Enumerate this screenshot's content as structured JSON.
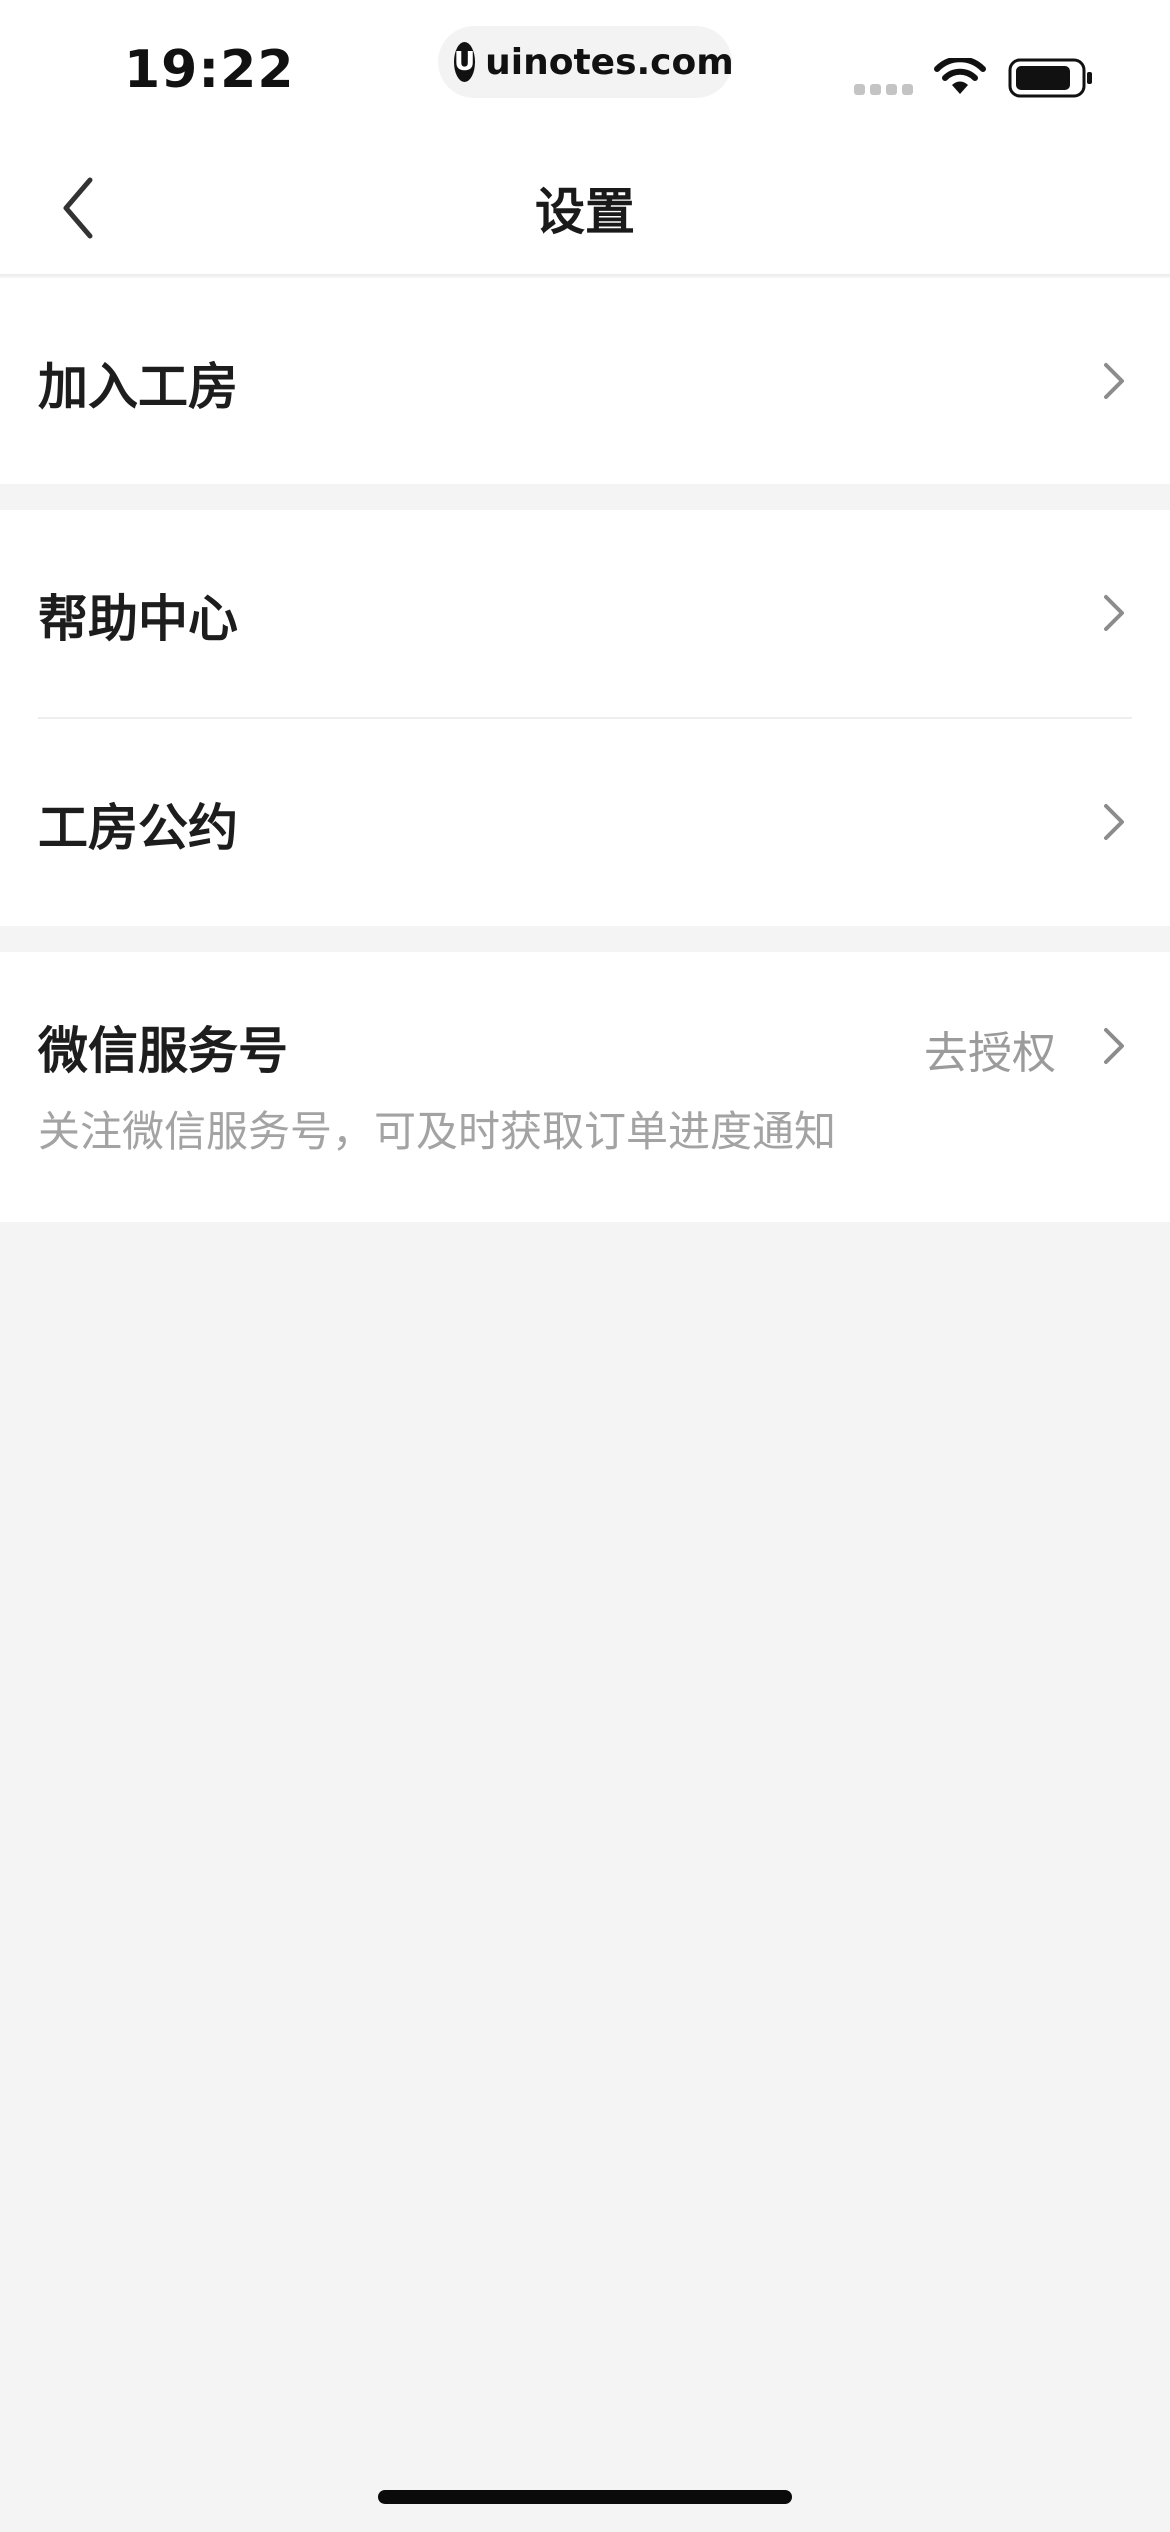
{
  "status_bar": {
    "time": "19:22",
    "url_logo": "U",
    "url": "uinotes.com"
  },
  "nav": {
    "title": "设置"
  },
  "settings": {
    "join_workshop": {
      "label": "加入工房"
    },
    "help_center": {
      "label": "帮助中心"
    },
    "workshop_rules": {
      "label": "工房公约"
    },
    "wechat_service": {
      "label": "微信服务号",
      "action": "去授权",
      "description": "关注微信服务号，可及时获取订单进度通知"
    }
  },
  "icons": {
    "back": "chevron-left-icon",
    "row_arrow": "chevron-right-icon",
    "wifi": "wifi-icon",
    "battery": "battery-icon"
  },
  "colors": {
    "background": "#f4f4f4",
    "surface": "#ffffff",
    "text_primary": "#1d1d1d",
    "text_secondary": "#9b9b9b"
  }
}
